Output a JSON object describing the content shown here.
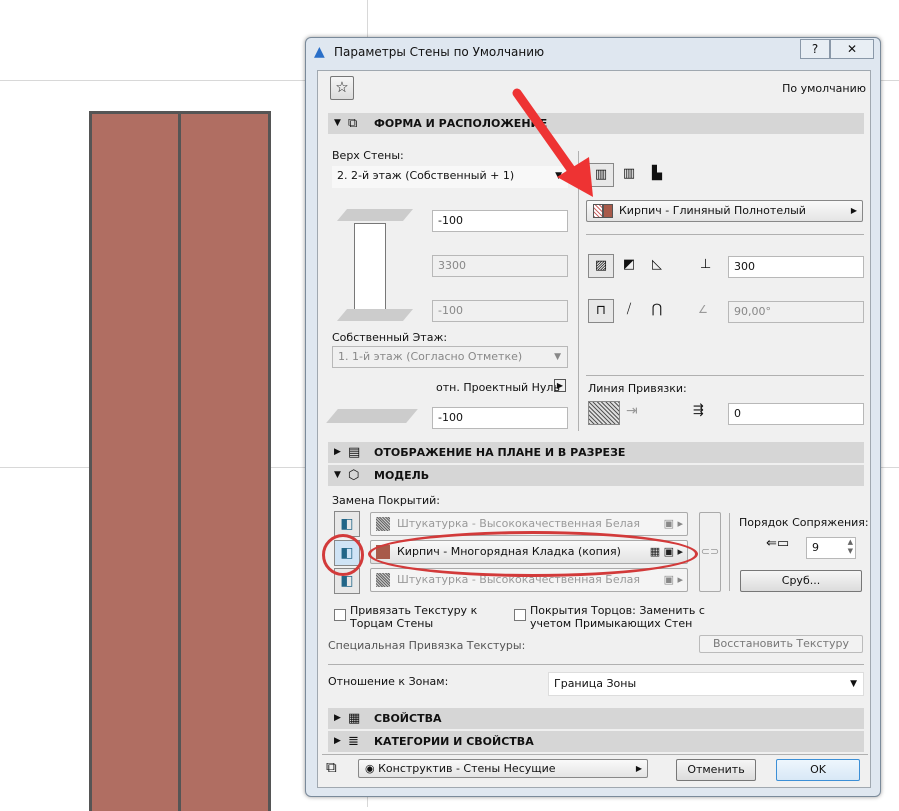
{
  "dialog": {
    "title": "Параметры Стены по Умолчанию",
    "help": "?",
    "close": "✕",
    "favorites_icon": "star-icon",
    "default_label": "По умолчанию"
  },
  "sections": {
    "shape": "ФОРМА И РАСПОЛОЖЕНИЕ",
    "plan": "ОТОБРАЖЕНИЕ НА ПЛАНЕ И В РАЗРЕЗЕ",
    "model": "МОДЕЛЬ",
    "props": "СВОЙСТВА",
    "cats": "КАТЕГОРИИ И СВОЙСТВА"
  },
  "shape": {
    "top_label": "Верх Стены:",
    "top_value": "2. 2-й этаж (Собственный + 1)",
    "top_offset": "-100",
    "height": "3300",
    "bottom_offset": "-100",
    "home_label": "Собственный Этаж:",
    "home_value": "1. 1-й этаж (Согласно Отметке)",
    "ref_label": "отн. Проектный Нуль",
    "ref_offset": "-100",
    "material": "Кирпич - Глиняный Полнотелый",
    "thickness": "300",
    "angle": "90,00°",
    "ref_line_label": "Линия Привязки:",
    "ref_line_offset": "0",
    "material_color": "#a85a4a"
  },
  "model": {
    "override_label": "Замена Покрытий:",
    "surfaces": [
      "Штукатурка - Высококачественная Белая",
      "Кирпич - Многорядная Кладка (копия)",
      "Штукатурка - Высококачественная Белая"
    ],
    "priority_label": "Порядок Сопряжения:",
    "priority_value": "9",
    "log_button": "Сруб...",
    "cb1": "Привязать Текстуру к Торцам Стены",
    "cb2": "Покрытия Торцов: Заменить с учетом Примыкающих Стен",
    "special_label": "Специальная Привязка Текстуры:",
    "reset_button": "Восстановить Текстуру",
    "zones_label": "Отношение к Зонам:",
    "zones_value": "Граница Зоны"
  },
  "footer": {
    "layer": "Конструктив - Стены Несущие",
    "cancel": "Отменить",
    "ok": "OK"
  },
  "colors": {
    "annotation": "#d23a3a",
    "wall": "#b06e62"
  }
}
